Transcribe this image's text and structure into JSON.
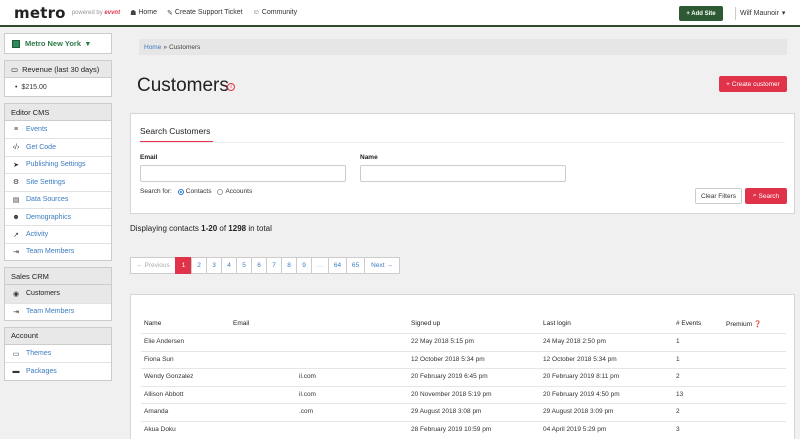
{
  "topbar": {
    "logo": "metro",
    "powered_by": "powered by",
    "powered_brand": "evvnt",
    "nav": [
      {
        "label": "Home",
        "icon": "sitemap-icon"
      },
      {
        "label": "Create Support Ticket",
        "icon": "wrench-icon"
      },
      {
        "label": "Community",
        "icon": "users-icon"
      }
    ],
    "add_site": "+ Add Site",
    "user_name": "Wilf Maunoir",
    "user_caret": "▾"
  },
  "sidebar": {
    "site_name": "Metro New York",
    "site_caret": "▾",
    "revenue_title": "Revenue (last 30 days)",
    "revenue_value": "$215.00",
    "editor_cms": {
      "title": "Editor CMS",
      "items": [
        {
          "label": "Events",
          "icon": "list-icon"
        },
        {
          "label": "Get Code",
          "icon": "code-icon"
        },
        {
          "label": "Publishing Settings",
          "icon": "paper-plane-icon"
        },
        {
          "label": "Site Settings",
          "icon": "cogs-icon"
        },
        {
          "label": "Data Sources",
          "icon": "database-icon"
        },
        {
          "label": "Demographics",
          "icon": "group-icon"
        },
        {
          "label": "Activity",
          "icon": "line-chart-icon"
        },
        {
          "label": "Team Members",
          "icon": "sign-in-icon"
        }
      ]
    },
    "sales_crm": {
      "title": "Sales CRM",
      "items": [
        {
          "label": "Customers",
          "icon": "user-circle-icon"
        },
        {
          "label": "Team Members",
          "icon": "sign-in-icon"
        }
      ]
    },
    "account": {
      "title": "Account",
      "items": [
        {
          "label": "Themes",
          "icon": "desktop-icon"
        },
        {
          "label": "Packages",
          "icon": "credit-card-icon"
        }
      ]
    }
  },
  "breadcrumb": {
    "home": "Home",
    "sep": "»",
    "current": "Customers"
  },
  "page_title": "Customers",
  "create_customer": "+ Create customer",
  "search": {
    "title": "Search Customers",
    "email_label": "Email",
    "name_label": "Name",
    "email_value": "",
    "name_value": "",
    "search_for_label": "Search for:",
    "option_contacts": "Contacts",
    "option_accounts": "Accounts",
    "selected": "Contacts",
    "clear_label": "Clear Filters",
    "search_label": "Search"
  },
  "displaying": {
    "prefix": "Displaying contacts ",
    "range": "1-20",
    "of": " of ",
    "total": "1298",
    "suffix": " in total"
  },
  "pagination": {
    "prev": "← Previous",
    "pages": [
      "1",
      "2",
      "3",
      "4",
      "5",
      "6",
      "7",
      "8",
      "9",
      "…",
      "64",
      "65"
    ],
    "current": "1",
    "next": "Next →"
  },
  "table": {
    "headers": {
      "name": "Name",
      "email": "Email",
      "signed_up": "Signed up",
      "last_login": "Last login",
      "events": "# Events",
      "premium": "Premium"
    },
    "rows": [
      {
        "name": "Elie Andersen",
        "email": "",
        "signed_up": "22 May 2018 5:15 pm",
        "last_login": "24 May 2018 2:50 pm",
        "events": "1"
      },
      {
        "name": "Fiona Sun",
        "email": "",
        "signed_up": "12 October 2018 5:34 pm",
        "last_login": "12 October 2018 5:34 pm",
        "events": "1"
      },
      {
        "name": "Wendy Gonzalez",
        "email": "il.com",
        "signed_up": "20 February 2019 6:45 pm",
        "last_login": "20 February 2019 8:11 pm",
        "events": "2"
      },
      {
        "name": "Allison Abbott",
        "email": "il.com",
        "signed_up": "20 November 2018 5:19 pm",
        "last_login": "20 February 2019 4:50 pm",
        "events": "13"
      },
      {
        "name": "Amanda",
        "email": ".com",
        "signed_up": "29 August 2018 3:08 pm",
        "last_login": "29 August 2018 3:09 pm",
        "events": "2"
      },
      {
        "name": "Akua Doku",
        "email": "",
        "signed_up": "28 February 2019 10:59 pm",
        "last_login": "04 April 2019 5:29 pm",
        "events": "3"
      }
    ]
  },
  "colors": {
    "accent": "#e0334a",
    "brand_green": "#2d5a32",
    "link": "#3b7bbf"
  }
}
